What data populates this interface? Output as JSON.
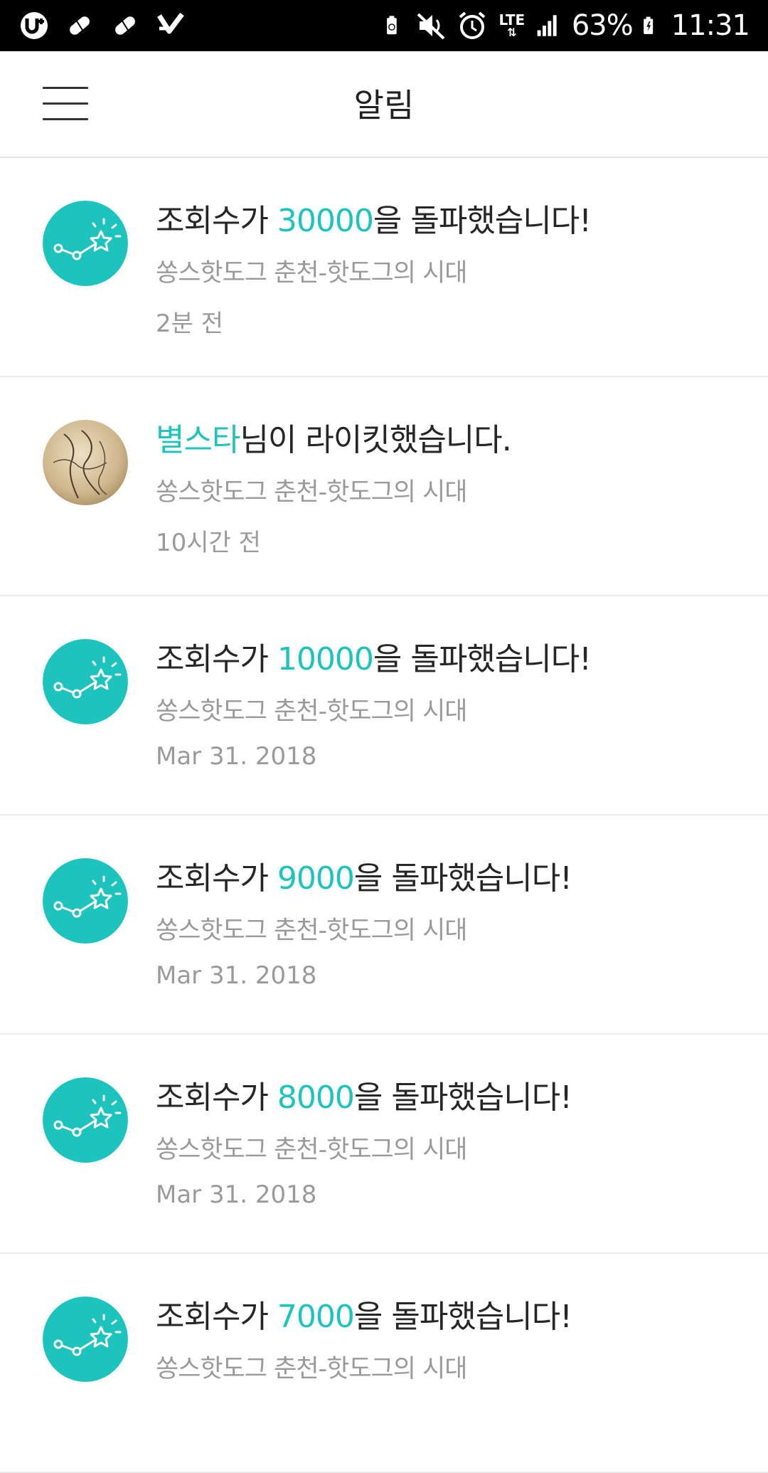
{
  "status_bar": {
    "battery_percent": "63%",
    "time": "11:31",
    "network": "LTE",
    "left_icons": [
      "u-plus-icon",
      "pill-icon",
      "pill-icon",
      "checkmark-icon"
    ],
    "right_icons": [
      "battery-saver-icon",
      "mute-icon",
      "alarm-icon",
      "lte-icon",
      "signal-icon",
      "battery-icon"
    ]
  },
  "app_bar": {
    "title": "알림",
    "menu_icon": "hamburger-menu-icon"
  },
  "colors": {
    "accent": "#1cc4bd",
    "text_primary": "#262626",
    "text_secondary": "#9a9a9a"
  },
  "notifications": [
    {
      "type": "milestone",
      "icon": "trend-chart-star-icon",
      "title_prefix": "조회수가 ",
      "title_accent": "30000",
      "title_suffix": "을 돌파했습니다!",
      "subtitle": "쏭스핫도그 춘천-핫도그의 시대",
      "time": "2분 전"
    },
    {
      "type": "like",
      "icon": "user-avatar",
      "title_prefix": "",
      "title_accent": "별스타",
      "title_suffix": "님이 라이킷했습니다.",
      "subtitle": "쏭스핫도그 춘천-핫도그의 시대",
      "time": "10시간 전"
    },
    {
      "type": "milestone",
      "icon": "trend-chart-star-icon",
      "title_prefix": "조회수가 ",
      "title_accent": "10000",
      "title_suffix": "을 돌파했습니다!",
      "subtitle": "쏭스핫도그 춘천-핫도그의 시대",
      "time": "Mar 31. 2018"
    },
    {
      "type": "milestone",
      "icon": "trend-chart-star-icon",
      "title_prefix": "조회수가 ",
      "title_accent": "9000",
      "title_suffix": "을 돌파했습니다!",
      "subtitle": "쏭스핫도그 춘천-핫도그의 시대",
      "time": "Mar 31. 2018"
    },
    {
      "type": "milestone",
      "icon": "trend-chart-star-icon",
      "title_prefix": "조회수가 ",
      "title_accent": "8000",
      "title_suffix": "을 돌파했습니다!",
      "subtitle": "쏭스핫도그 춘천-핫도그의 시대",
      "time": "Mar 31. 2018"
    },
    {
      "type": "milestone",
      "icon": "trend-chart-star-icon",
      "title_prefix": "조회수가 ",
      "title_accent": "7000",
      "title_suffix": "을 돌파했습니다!",
      "subtitle": "쏭스핫도그 춘천-핫도그의 시대",
      "time": ""
    }
  ]
}
